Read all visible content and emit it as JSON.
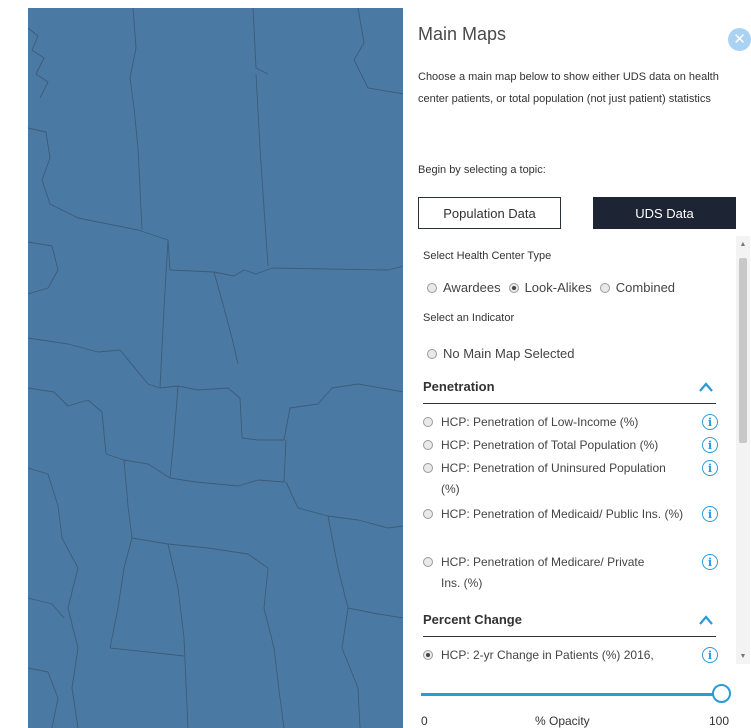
{
  "panel": {
    "title": "Main Maps",
    "close_icon": "close-icon",
    "intro": "Choose a main map below to show either UDS data on health center patients, or total population (not just patient) statistics",
    "topic_label": "Begin by selecting a topic:",
    "buttons": {
      "population": "Population Data",
      "uds": "UDS Data",
      "selected": "uds"
    },
    "health_center_type": {
      "label": "Select Health Center Type",
      "options": [
        {
          "label": "Awardees",
          "checked": false
        },
        {
          "label": "Look-Alikes",
          "checked": true
        },
        {
          "label": "Combined",
          "checked": false
        }
      ]
    },
    "indicator": {
      "label": "Select an Indicator",
      "none_option": "No Main Map Selected"
    },
    "sections": [
      {
        "title": "Penetration",
        "expanded": true,
        "items": [
          {
            "label": "HCP: Penetration of Low-Income (%)"
          },
          {
            "label": "HCP: Penetration of Total Population (%)"
          },
          {
            "label": "HCP: Penetration of Uninsured Population (%)"
          },
          {
            "label": "HCP: Penetration of Medicaid/ Public Ins. (%)"
          },
          {
            "label": "HCP: Penetration of Medicare/ Private Ins. (%)"
          }
        ]
      },
      {
        "title": "Percent Change",
        "expanded": true,
        "items": [
          {
            "label": "HCP: 2-yr Change in Patients (%) 2016,"
          }
        ]
      }
    ],
    "opacity": {
      "min": "0",
      "label": "% Opacity",
      "max": "100",
      "value": 100
    }
  },
  "colors": {
    "map_fill": "#4a7aa4",
    "accent": "#2a9ad8",
    "dark_button": "#1d2433"
  }
}
